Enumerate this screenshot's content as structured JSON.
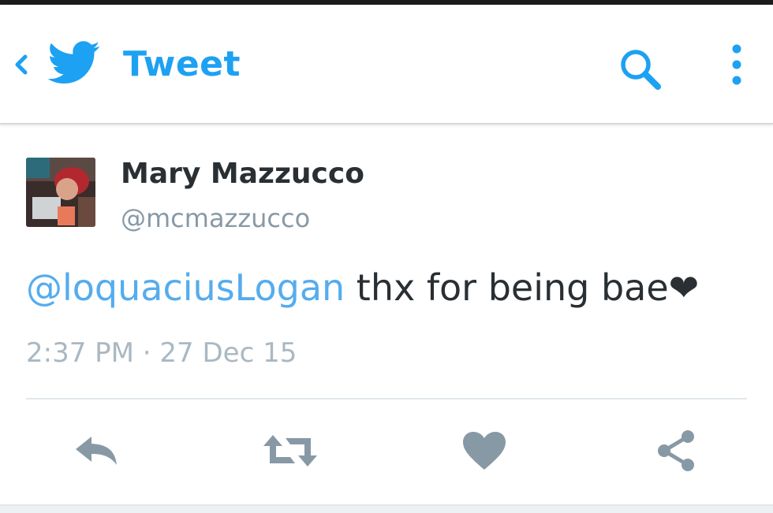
{
  "header": {
    "title": "Tweet",
    "back_icon": "chevron-left-icon",
    "logo_icon": "twitter-bird-icon",
    "search_icon": "search-icon",
    "menu_icon": "overflow-menu-icon",
    "accent_color": "#1da1f2"
  },
  "tweet": {
    "author": {
      "display_name": "Mary Mazzucco",
      "handle": "@mcmazzucco"
    },
    "mention": "@loquaciusLogan",
    "text": " thx for being bae❤",
    "timestamp": "2:37 PM · 27 Dec 15",
    "actions": [
      {
        "name": "reply",
        "icon": "reply-icon"
      },
      {
        "name": "retweet",
        "icon": "retweet-icon"
      },
      {
        "name": "like",
        "icon": "heart-icon"
      },
      {
        "name": "share",
        "icon": "share-icon"
      }
    ],
    "action_color": "#8899a6"
  }
}
